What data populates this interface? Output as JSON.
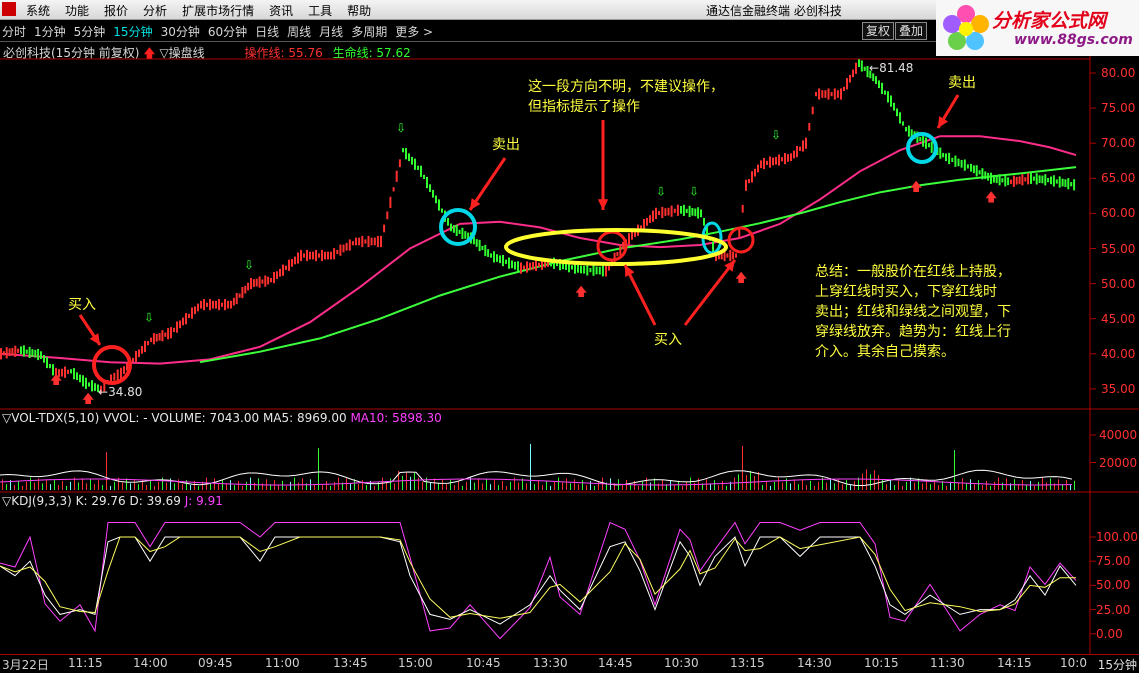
{
  "menubar": {
    "items": [
      "系统",
      "功能",
      "报价",
      "分析",
      "扩展市场行情",
      "资讯",
      "工具",
      "帮助"
    ],
    "app_title": "通达信金融终端  必创科技"
  },
  "brand": {
    "name": "分析家公式网",
    "url": "www.88gs.com"
  },
  "toolbar": {
    "periods": [
      "分时",
      "1分钟",
      "5分钟",
      "15分钟",
      "30分钟",
      "60分钟",
      "日线",
      "周线",
      "月线",
      "多周期",
      "更多 >"
    ],
    "active": "15分钟",
    "buttons": [
      "复权",
      "叠加"
    ]
  },
  "stock": {
    "title": "必创科技(15分钟 前复权)",
    "indicator": "▽操盘线",
    "op_line": "操作线: 55.76",
    "life_line": "生命线: 57.62"
  },
  "price_axis": [
    "80.00",
    "75.00",
    "70.00",
    "65.00",
    "60.00",
    "55.00",
    "50.00",
    "45.00",
    "40.00",
    "35.00"
  ],
  "price_labels": {
    "high": "81.48",
    "low": "34.80"
  },
  "vol_panel": {
    "label": "▽VOL-TDX(5,10)  VVOL: -   VOLUME: 7043.00  MA5: 8969.00",
    "ma10": "MA10: 5898.30",
    "axis": [
      "40000",
      "20000"
    ]
  },
  "kdj_panel": {
    "label": "▽KDJ(9,3,3)  K: 29.76  D: 39.69",
    "j": "J: 9.91",
    "axis": [
      "100.00",
      "75.00",
      "50.00",
      "25.00",
      "0.00"
    ]
  },
  "annotations": {
    "buy1": "买入",
    "sell1": "卖出",
    "sell2": "卖出",
    "buy2": "买入",
    "unclear_line1": "这一段方向不明，不建议操作，",
    "unclear_line2": "但指标提示了操作",
    "summary": [
      "总结：一般股价在红线上持股，",
      "上穿红线时买入，下穿红线时",
      "卖出；红线和绿线之间观望，下",
      "穿绿线放弃。趋势为：红线上行",
      "介入。其余自己摸索。"
    ]
  },
  "timebar": {
    "labels": [
      "3月22日",
      "11:15",
      "14:00",
      "09:45",
      "11:00",
      "13:45",
      "15:00",
      "10:45",
      "13:30",
      "14:45",
      "10:30",
      "13:15",
      "14:30",
      "10:15",
      "11:30",
      "14:15",
      "10:0"
    ],
    "period": "15分钟"
  },
  "colors": {
    "ma_red": "#ff2d8a",
    "ma_green": "#3cff3c",
    "candle_up": "#ff3030",
    "candle_down": "#30ff30",
    "annotation": "#ff2020",
    "text_yellow": "#ffff40",
    "circle_cyan": "#00d8e8"
  }
}
